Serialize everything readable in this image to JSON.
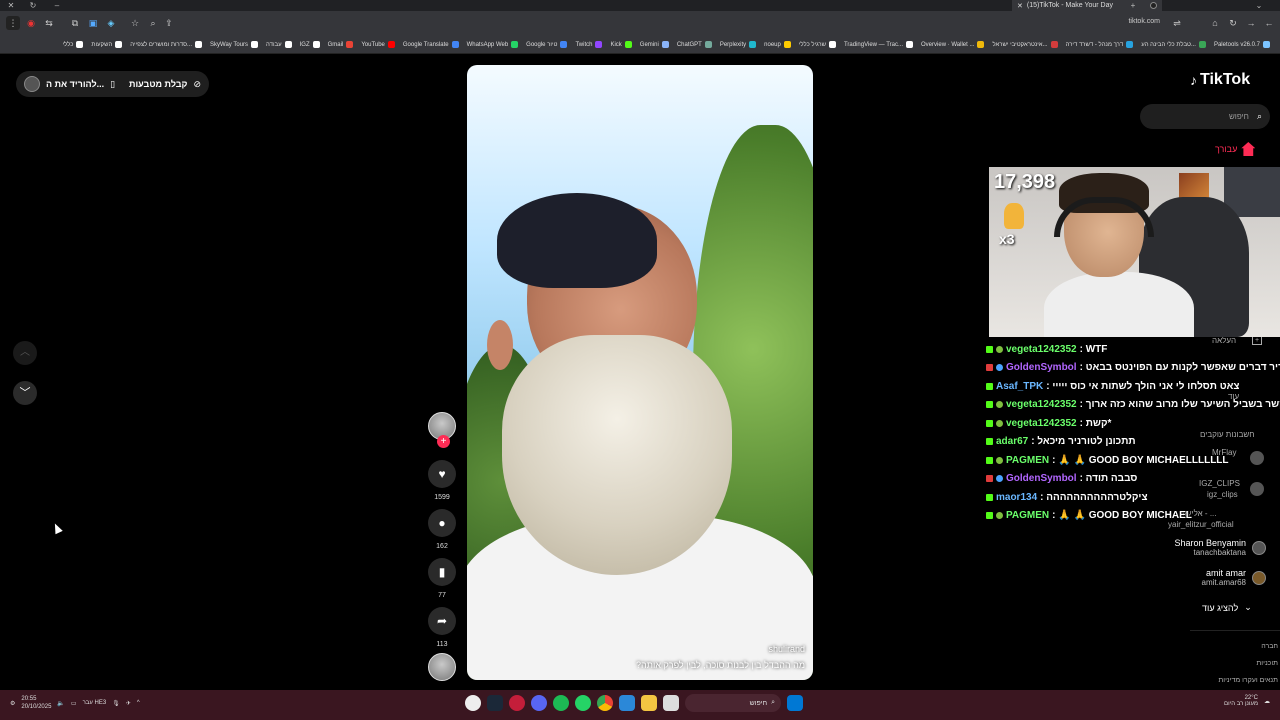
{
  "browser": {
    "tab_title": "(15)TikTok - Make Your Day",
    "url": "tiktok.com",
    "bookmarks": [
      {
        "label": "Paletools v26.0.7",
        "color": "#7cc4ff"
      },
      {
        "label": "טבלת כלי הבינה הע...",
        "color": "#3aa657"
      },
      {
        "label": "דרך מנהל - דשרד דירה",
        "color": "#27a3e0"
      },
      {
        "label": "אינטראקטיבי ישראל...",
        "color": "#d23c3c"
      },
      {
        "label": "Overview · Wallet ...",
        "color": "#f0b90b"
      },
      {
        "label": "TradingView — Trac...",
        "color": "#ffffff"
      },
      {
        "label": "שרגיל כללי",
        "color": "#ffffff"
      },
      {
        "label": "noeup",
        "color": "#ffcc00"
      },
      {
        "label": "Perplexity",
        "color": "#20b8cd"
      },
      {
        "label": "ChatGPT",
        "color": "#74aa9c"
      },
      {
        "label": "Gemini",
        "color": "#8ab4f8"
      },
      {
        "label": "Kick",
        "color": "#53fc18"
      },
      {
        "label": "Twitch",
        "color": "#9146ff"
      },
      {
        "label": "Google טיור",
        "color": "#4285f4"
      },
      {
        "label": "WhatsApp Web",
        "color": "#25d366"
      },
      {
        "label": "Google Translate",
        "color": "#4285f4"
      },
      {
        "label": "YouTube",
        "color": "#ff0000"
      },
      {
        "label": "Gmail",
        "color": "#ea4335"
      },
      {
        "label": "IGZ",
        "color": "#ffffff"
      },
      {
        "label": "עבודה",
        "color": "#ffffff"
      },
      {
        "label": "SkyWay Tours",
        "color": "#ffffff"
      },
      {
        "label": "סדרות ומושרים לצפייה...",
        "color": "#ffffff"
      },
      {
        "label": "השקעות",
        "color": "#ffffff"
      },
      {
        "label": "כללי",
        "color": "#ffffff"
      }
    ]
  },
  "topleft": {
    "coins_label": "קבלת מטבעות",
    "download_label": "להוריד את ה..."
  },
  "video": {
    "username": "shulirand",
    "caption": "מה ההבדל בין לבנות סוכה, לבין לפרק אותה?"
  },
  "actions": {
    "likes": "1599",
    "comments": "162",
    "saves": "77",
    "shares": "113"
  },
  "sidebar": {
    "logo": "TikTok",
    "search_placeholder": "חיפוש",
    "for_you": "עבורך",
    "following_accounts_label": "חשבונות עוקבים",
    "show_more": "להציג עוד",
    "accounts": [
      {
        "name": "Sharon Benyamin",
        "handle": "tanachbaktana"
      },
      {
        "name": "amit amar",
        "handle": "amit.amar68"
      }
    ],
    "dim_items": [
      "העלאה",
      "עוד",
      "MrFlay",
      "IGZ_CLIPS",
      "igz_clips",
      "אליעזר - ...",
      "yair_elitzur_official"
    ],
    "footer": [
      "חברה",
      "תוכניות",
      "תנאים ועקרו מדיניות"
    ]
  },
  "stream": {
    "counter": "17,398",
    "multiplier": "x3"
  },
  "chat": [
    {
      "user": "vegeta1242352",
      "msg": ": WTF",
      "color": "#6bff6b",
      "b1": "#53fc18",
      "b2": "#7fbf3f"
    },
    {
      "user": "GoldenSymbol",
      "msg": ": מגדיר דברים שאפשר לקנות עם הפוינטס בבאט",
      "color": "#b266ff",
      "b1": "#e03c3c",
      "b2": "#4aa3ff"
    },
    {
      "user": "Asaf_TPK",
      "msg": ": צאט תסלחו לי אני הולך לשתות אי כוס ייייי",
      "color": "#6ab7ff",
      "b1": "#53fc18",
      "b2": ""
    },
    {
      "user": "vegeta1242352",
      "msg": ": קשר בשביל השיער שלו מרוב שהוא כזה ארוך",
      "color": "#6bff6b",
      "b1": "#53fc18",
      "b2": "#7fbf3f"
    },
    {
      "user": "vegeta1242352",
      "msg": ": קשת*",
      "color": "#6bff6b",
      "b1": "#53fc18",
      "b2": "#7fbf3f"
    },
    {
      "user": "adar67",
      "msg": ": תתכונן לטורניר מיכאל",
      "color": "#6bff6b",
      "b1": "#53fc18",
      "b2": ""
    },
    {
      "user": "PAGMEN",
      "msg": ":  🙏  🙏  GOOD BOY MICHAELLLLLLL",
      "color": "#6bff6b",
      "b1": "#53fc18",
      "b2": "#7fbf3f"
    },
    {
      "user": "GoldenSymbol",
      "msg": ": סבבה תודה",
      "color": "#b266ff",
      "b1": "#e03c3c",
      "b2": "#4aa3ff"
    },
    {
      "user": "maor134",
      "msg": ": ציקלטרהההההההההה",
      "color": "#6ab7ff",
      "b1": "#53fc18",
      "b2": ""
    },
    {
      "user": "PAGMEN",
      "msg": ":  🙏  🙏  GOOD BOY MICHAEL",
      "color": "#6bff6b",
      "b1": "#53fc18",
      "b2": "#7fbf3f"
    }
  ],
  "taskbar": {
    "time": "20:55",
    "date": "20/10/2025",
    "lang": "עבר HE3",
    "search_placeholder": "חיפוש",
    "weather": "22°C",
    "weather_desc": "מעונן רב היום"
  }
}
